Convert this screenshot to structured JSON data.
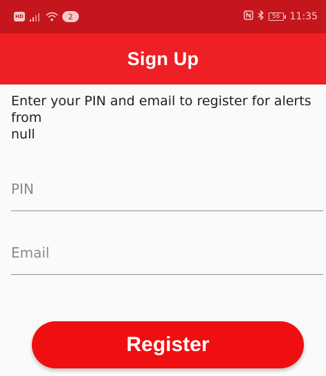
{
  "status_bar": {
    "hd_label": "HD",
    "notification_count": "2",
    "battery_level": "56",
    "time": "11:35"
  },
  "app_bar": {
    "title": "Sign Up"
  },
  "instructions": {
    "line1": "Enter your PIN and email to register for alerts",
    "line2": "from",
    "line3": "null"
  },
  "form": {
    "pin": {
      "placeholder": "PIN",
      "value": ""
    },
    "email": {
      "placeholder": "Email",
      "value": ""
    },
    "register_label": "Register"
  },
  "colors": {
    "status_bar": "#c4161c",
    "app_bar": "#ee1f25",
    "button": "#ef0f10",
    "background": "#fafafa"
  },
  "icons": [
    "hd-badge-icon",
    "signal-icon",
    "wifi-icon",
    "nfc-icon",
    "bluetooth-icon",
    "battery-icon"
  ]
}
